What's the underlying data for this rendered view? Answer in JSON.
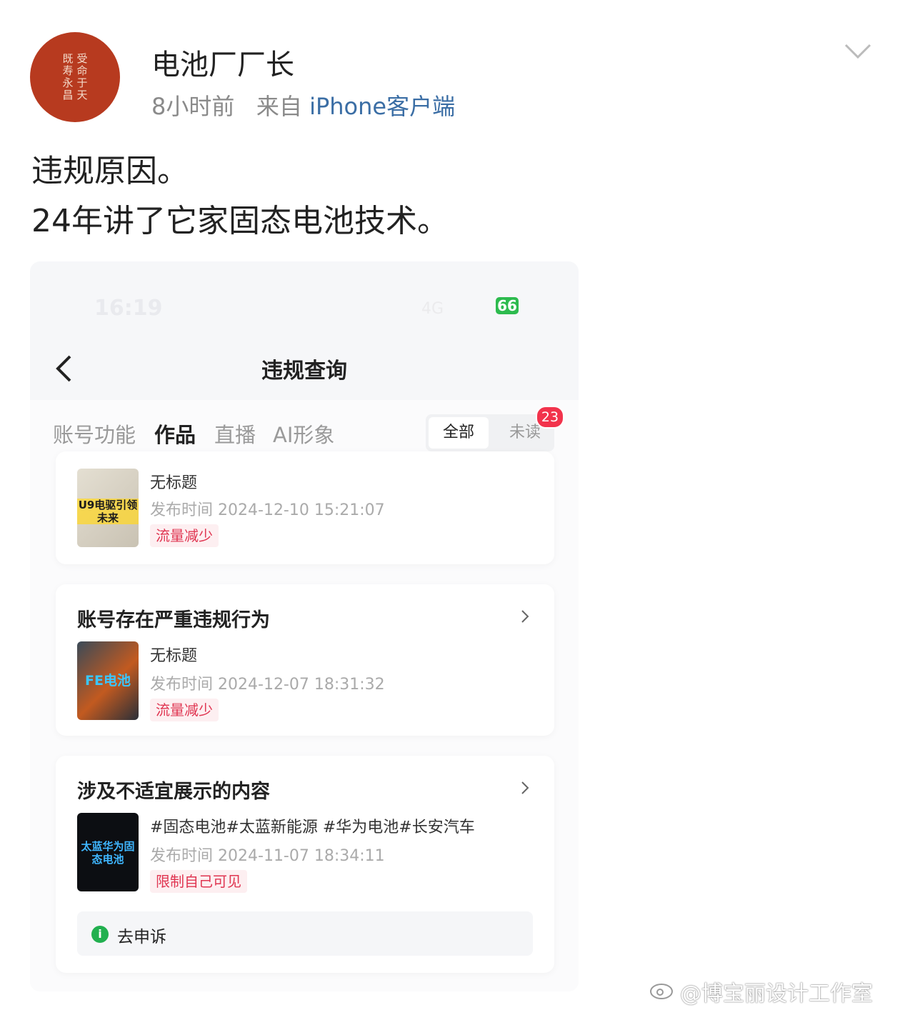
{
  "post": {
    "avatar_text": [
      "既寿永昌",
      "受命于天"
    ],
    "author": "电池厂厂长",
    "time": "8小时前",
    "from_label": "来自",
    "client": "iPhone客户端",
    "lines": [
      "违规原因。",
      "24年讲了它家固态电池技术。"
    ]
  },
  "screenshot": {
    "status": {
      "time": "16:19",
      "signal": "4G",
      "battery": "66"
    },
    "nav": {
      "title": "违规查询"
    },
    "tabs": [
      {
        "label": "账号功能",
        "active": false
      },
      {
        "label": "作品",
        "active": true
      },
      {
        "label": "直播",
        "active": false
      },
      {
        "label": "AI形象",
        "active": false
      }
    ],
    "segment": {
      "all": "全部",
      "unread": "未读",
      "unread_badge": "23"
    },
    "cards": [
      {
        "items": [
          {
            "thumb_text": "U9电驱引领未来",
            "title": "无标题",
            "time_label": "发布时间",
            "time": "2024-12-10 15:21:07",
            "tag": "流量减少"
          }
        ]
      },
      {
        "title": "账号存在严重违规行为",
        "items": [
          {
            "thumb_text": "FE电池",
            "title": "无标题",
            "time_label": "发布时间",
            "time": "2024-12-07 18:31:32",
            "tag": "流量减少"
          }
        ]
      },
      {
        "title": "涉及不适宜展示的内容",
        "items": [
          {
            "thumb_text": "太蓝华为固态电池",
            "title": "#固态电池#太蓝新能源 #华为电池#长安汽车",
            "time_label": "发布时间",
            "time": "2024-11-07 18:34:11",
            "tag": "限制自己可见"
          }
        ],
        "appeal": "去申诉"
      }
    ]
  },
  "watermark": "@博宝丽设计工作室",
  "colors": {
    "avatar": "#b73a1f",
    "client_link": "#3b6ea5",
    "tag_red": "#e03551",
    "badge": "#f2334c",
    "appeal_icon": "#22b04f",
    "battery": "#2dbb4e"
  }
}
